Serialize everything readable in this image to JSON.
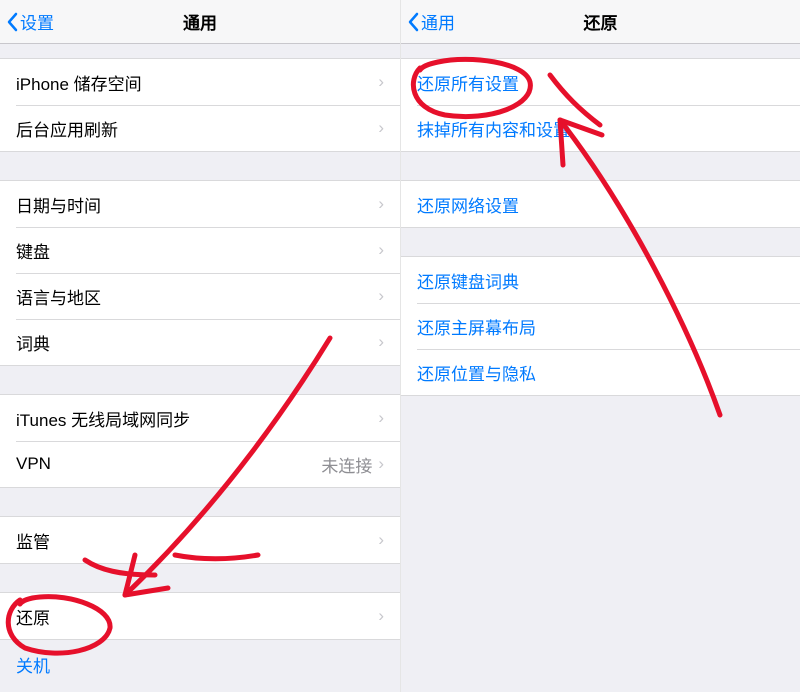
{
  "left": {
    "back_label": "设置",
    "title": "通用",
    "group1": {
      "storage": "iPhone 储存空间",
      "background_refresh": "后台应用刷新"
    },
    "group2": {
      "date_time": "日期与时间",
      "keyboard": "键盘",
      "language_region": "语言与地区",
      "dictionary": "词典"
    },
    "group3": {
      "itunes_wifi": "iTunes 无线局域网同步",
      "vpn": "VPN",
      "vpn_value": "未连接"
    },
    "group4": {
      "supervision": "监管"
    },
    "group5": {
      "reset": "还原"
    },
    "shutdown": "关机"
  },
  "right": {
    "back_label": "通用",
    "title": "还原",
    "group1": {
      "reset_all": "还原所有设置",
      "erase_all": "抹掉所有内容和设置"
    },
    "group2": {
      "reset_network": "还原网络设置"
    },
    "group3": {
      "reset_keyboard_dict": "还原键盘词典",
      "reset_home": "还原主屏幕布局",
      "reset_location": "还原位置与隐私"
    }
  }
}
